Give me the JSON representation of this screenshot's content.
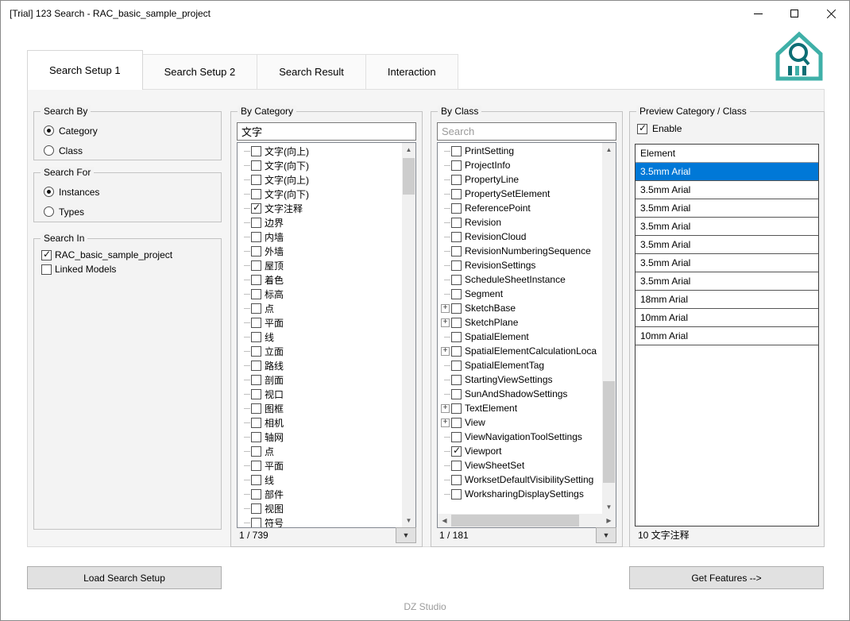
{
  "window": {
    "title": "[Trial] 123 Search - RAC_basic_sample_project"
  },
  "footer": {
    "text": "DZ Studio"
  },
  "colors": {
    "selection_blue": "#0078d7",
    "logo_teal": "#3fb0a8",
    "logo_dark": "#0d6e74"
  },
  "tabs": [
    {
      "label": "Search Setup 1",
      "active": true
    },
    {
      "label": "Search Setup 2",
      "active": false
    },
    {
      "label": "Search Result",
      "active": false
    },
    {
      "label": "Interaction",
      "active": false
    }
  ],
  "search_by": {
    "title": "Search By",
    "options": [
      {
        "label": "Category",
        "selected": true
      },
      {
        "label": "Class",
        "selected": false
      }
    ]
  },
  "search_for": {
    "title": "Search For",
    "options": [
      {
        "label": "Instances",
        "selected": true
      },
      {
        "label": "Types",
        "selected": false
      }
    ]
  },
  "search_in": {
    "title": "Search In",
    "items": [
      {
        "label": "RAC_basic_sample_project",
        "checked": true
      },
      {
        "label": "Linked Models",
        "checked": false
      }
    ]
  },
  "by_category": {
    "title": "By Category",
    "filter_value": "文字",
    "status": "1 / 739",
    "items": [
      {
        "label": "文字(向上)",
        "checked": false
      },
      {
        "label": "文字(向下)",
        "checked": false
      },
      {
        "label": "文字(向上)",
        "checked": false
      },
      {
        "label": "文字(向下)",
        "checked": false
      },
      {
        "label": "文字注释",
        "checked": true
      },
      {
        "label": "边界",
        "checked": false
      },
      {
        "label": "内墙",
        "checked": false
      },
      {
        "label": "外墙",
        "checked": false
      },
      {
        "label": "屋顶",
        "checked": false
      },
      {
        "label": "着色",
        "checked": false
      },
      {
        "label": "标高",
        "checked": false
      },
      {
        "label": "点",
        "checked": false
      },
      {
        "label": "平面",
        "checked": false
      },
      {
        "label": "线",
        "checked": false
      },
      {
        "label": "立面",
        "checked": false
      },
      {
        "label": "路线",
        "checked": false
      },
      {
        "label": "剖面",
        "checked": false
      },
      {
        "label": "视口",
        "checked": false
      },
      {
        "label": "图框",
        "checked": false
      },
      {
        "label": "相机",
        "checked": false
      },
      {
        "label": "轴网",
        "checked": false
      },
      {
        "label": "点",
        "checked": false
      },
      {
        "label": "平面",
        "checked": false
      },
      {
        "label": "线",
        "checked": false
      },
      {
        "label": "部件",
        "checked": false
      },
      {
        "label": "视图",
        "checked": false
      },
      {
        "label": "符号",
        "checked": false
      }
    ]
  },
  "by_class": {
    "title": "By Class",
    "search_placeholder": "Search",
    "status": "1 / 181",
    "items": [
      {
        "label": "PrintSetting",
        "checked": false,
        "expandable": false
      },
      {
        "label": "ProjectInfo",
        "checked": false,
        "expandable": false
      },
      {
        "label": "PropertyLine",
        "checked": false,
        "expandable": false
      },
      {
        "label": "PropertySetElement",
        "checked": false,
        "expandable": false
      },
      {
        "label": "ReferencePoint",
        "checked": false,
        "expandable": false
      },
      {
        "label": "Revision",
        "checked": false,
        "expandable": false
      },
      {
        "label": "RevisionCloud",
        "checked": false,
        "expandable": false
      },
      {
        "label": "RevisionNumberingSequence",
        "checked": false,
        "expandable": false
      },
      {
        "label": "RevisionSettings",
        "checked": false,
        "expandable": false
      },
      {
        "label": "ScheduleSheetInstance",
        "checked": false,
        "expandable": false
      },
      {
        "label": "Segment",
        "checked": false,
        "expandable": false
      },
      {
        "label": "SketchBase",
        "checked": false,
        "expandable": true
      },
      {
        "label": "SketchPlane",
        "checked": false,
        "expandable": true
      },
      {
        "label": "SpatialElement",
        "checked": false,
        "expandable": false
      },
      {
        "label": "SpatialElementCalculationLoca",
        "checked": false,
        "expandable": true
      },
      {
        "label": "SpatialElementTag",
        "checked": false,
        "expandable": false
      },
      {
        "label": "StartingViewSettings",
        "checked": false,
        "expandable": false
      },
      {
        "label": "SunAndShadowSettings",
        "checked": false,
        "expandable": false
      },
      {
        "label": "TextElement",
        "checked": false,
        "expandable": true
      },
      {
        "label": "View",
        "checked": false,
        "expandable": true
      },
      {
        "label": "ViewNavigationToolSettings",
        "checked": false,
        "expandable": false
      },
      {
        "label": "Viewport",
        "checked": true,
        "expandable": false
      },
      {
        "label": "ViewSheetSet",
        "checked": false,
        "expandable": false
      },
      {
        "label": "WorksetDefaultVisibilitySetting",
        "checked": false,
        "expandable": false
      },
      {
        "label": "WorksharingDisplaySettings",
        "checked": false,
        "expandable": false
      }
    ]
  },
  "preview": {
    "title": "Preview Category / Class",
    "enable_label": "Enable",
    "enable_checked": true,
    "column_header": "Element",
    "status": "10 文字注释",
    "rows": [
      {
        "label": "3.5mm Arial",
        "selected": true
      },
      {
        "label": "3.5mm Arial",
        "selected": false
      },
      {
        "label": "3.5mm Arial",
        "selected": false
      },
      {
        "label": "3.5mm Arial",
        "selected": false
      },
      {
        "label": "3.5mm Arial",
        "selected": false
      },
      {
        "label": "3.5mm Arial",
        "selected": false
      },
      {
        "label": "3.5mm Arial",
        "selected": false
      },
      {
        "label": "18mm Arial",
        "selected": false
      },
      {
        "label": "10mm Arial",
        "selected": false
      },
      {
        "label": "10mm Arial",
        "selected": false
      }
    ]
  },
  "buttons": {
    "load_search_setup": "Load Search Setup",
    "get_features": "Get Features  -->"
  }
}
